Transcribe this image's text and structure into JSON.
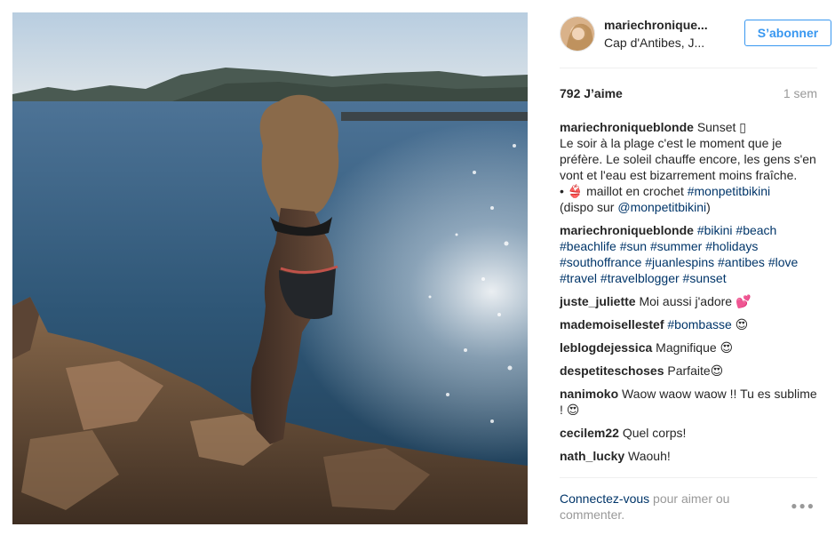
{
  "post": {
    "author": "mariechronique...",
    "location": "Cap d'Antibes, J...",
    "follow_label": "S’abonner",
    "likes": "792 J’aime",
    "time_ago": "1 sem"
  },
  "caption": {
    "author": "mariechroniqueblonde",
    "line1": "Sunset ▯",
    "line2": "Le soir à la plage c'est le moment que je préfère. Le soleil chauffe encore, les gens s'en vont et l'eau est bizarrement moins fraîche.",
    "line3_prefix": "• 👙 maillot en crochet ",
    "line3_tag": "#monpetitbikini",
    "line4_prefix": "(dispo sur ",
    "line4_mention": "@monpetitbikini",
    "line4_suffix": ")"
  },
  "hashtags_comment": {
    "author": "mariechroniqueblonde",
    "tags": [
      "#bikini",
      "#beach",
      "#beachlife",
      "#sun",
      "#summer",
      "#holidays",
      "#southoffrance",
      "#juanlespins",
      "#antibes",
      "#love",
      "#travel",
      "#travelblogger",
      "#sunset"
    ]
  },
  "comments": [
    {
      "author": "juste_juliette",
      "text": "Moi aussi j'adore 💕"
    },
    {
      "author": "mademoisellestef",
      "tag": "#bombasse",
      "text": "😍"
    },
    {
      "author": "leblogdejessica",
      "text": "Magnifique 😍"
    },
    {
      "author": "despetiteschoses",
      "text": "Parfaite😍"
    },
    {
      "author": "nanimoko",
      "text": "Waow waow waow !! Tu es sublime ! 😍"
    },
    {
      "author": "cecilem22",
      "text": "Quel corps!"
    },
    {
      "author": "nath_lucky",
      "text": "Waouh!"
    }
  ],
  "footer": {
    "login_link": "Connectez-vous",
    "login_rest": " pour aimer ou commenter.",
    "more_icon": "more-options-icon"
  },
  "colors": {
    "accent": "#3897f0",
    "link": "#003569",
    "muted": "#999999",
    "text": "#262626"
  }
}
